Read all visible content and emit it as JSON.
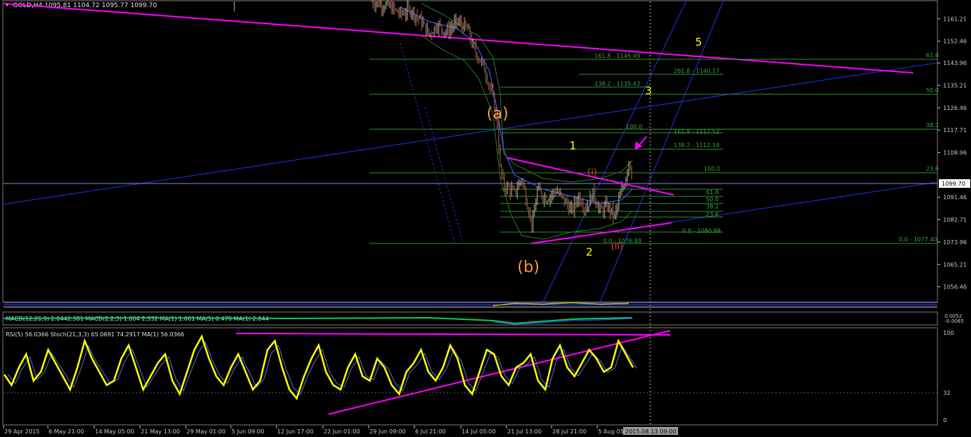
{
  "symbol_header": "GOLD,H4  1095.81 1104.72 1095.77 1099.70",
  "macd_header": "MACD(12,26,9) 2.0442.381 MACD(2,2,3) 1.004 2.332 MA(1) 1.001 MA(5) 0.470 MA(1) 2.044",
  "rsi_header": "RSI(5) 56.0366  Stoch(21,3,3) 65.0691 74.2917  MA(1) 56.0366",
  "current_price": "1099.70",
  "cursor_time": "2015.08.13 09:00",
  "colors": {
    "bg": "#000000",
    "grid": "#1e1e1e",
    "magenta": "#ff00ff",
    "blue": "#1c33e6",
    "fib": "#2f8f2f",
    "yellow": "#ffff00",
    "orange": "#ff9933",
    "red": "#e53b2c"
  },
  "chart_data": [
    {
      "type": "line",
      "name": "price",
      "ylim": [
        1050.5,
        1168
      ],
      "y_ticks": [
        "1161.21",
        "1152.46",
        "1143.96",
        "1135.21",
        "1126.46",
        "1117.71",
        "1108.96",
        "1099.70",
        "1091.46",
        "1082.71",
        "1073.96",
        "1065.21",
        "1056.46"
      ],
      "x_ticks": [
        "29 Apr 2015",
        "6 May 21:00",
        "14 May 05:00",
        "21 May 13:00",
        "29 May 01:00",
        "5 Jun 09:00",
        "12 Jun 17:00",
        "22 Jun 01:00",
        "29 Jun 09:00",
        "6 Jul 21:00",
        "14 Jul 05:00",
        "21 Jul 13:00",
        "28 Jul 21:00",
        "5 Aug 05:00"
      ],
      "price_path": [
        [
          520,
          1168
        ],
        [
          545,
          1166
        ],
        [
          560,
          1163
        ],
        [
          575,
          1165
        ],
        [
          590,
          1160
        ],
        [
          600,
          1155
        ],
        [
          612,
          1159
        ],
        [
          625,
          1156
        ],
        [
          640,
          1160
        ],
        [
          655,
          1157
        ],
        [
          662,
          1150
        ],
        [
          672,
          1145
        ],
        [
          680,
          1140
        ],
        [
          690,
          1130
        ],
        [
          696,
          1120
        ],
        [
          700,
          1103
        ],
        [
          705,
          1096
        ],
        [
          712,
          1095
        ],
        [
          720,
          1093
        ],
        [
          730,
          1099
        ],
        [
          745,
          1080
        ],
        [
          752,
          1094
        ],
        [
          765,
          1091
        ],
        [
          778,
          1094
        ],
        [
          790,
          1090
        ],
        [
          800,
          1086
        ],
        [
          810,
          1092
        ],
        [
          820,
          1087
        ],
        [
          830,
          1093
        ],
        [
          840,
          1086
        ],
        [
          850,
          1088
        ],
        [
          860,
          1084
        ],
        [
          868,
          1092
        ],
        [
          874,
          1097
        ],
        [
          880,
          1106
        ],
        [
          885,
          1099.7
        ]
      ],
      "fibonacci_labels": [
        "161.8 - 1145.49",
        "261.8 - 1140.17",
        "138.2 - 1135.43",
        "100.0",
        "161.8 - 1117.52",
        "138.2 - 1112.18",
        "100.0",
        "0.0 - 1077.40",
        "61.8",
        "50.0",
        "38.2",
        "23.6",
        "0.0 - 1080.88",
        "0.0 - 1076.88",
        "61.8",
        "50.0",
        "38.2",
        "23.6"
      ],
      "wave_labels": [
        {
          "text": "(a)",
          "color": "orange"
        },
        {
          "text": "(b)",
          "color": "orange"
        },
        {
          "text": "1",
          "color": "yellow"
        },
        {
          "text": "2",
          "color": "yellow"
        },
        {
          "text": "3",
          "color": "yellow"
        },
        {
          "text": "5",
          "color": "yellow"
        },
        {
          "text": "(i)",
          "color": "red"
        },
        {
          "text": "(ii)",
          "color": "red"
        }
      ]
    },
    {
      "type": "line",
      "name": "MACD",
      "y_ticks": [
        "0.0052",
        "-0.0065"
      ]
    },
    {
      "type": "line",
      "name": "RSI/Stoch",
      "ylim": [
        0,
        100
      ],
      "y_ticks": [
        "100",
        "32",
        "0"
      ],
      "rsi": [
        52,
        40,
        60,
        75,
        45,
        55,
        80,
        65,
        50,
        35,
        60,
        90,
        70,
        55,
        40,
        45,
        70,
        85,
        60,
        35,
        50,
        65,
        75,
        45,
        30,
        55,
        80,
        95,
        70,
        50,
        40,
        60,
        75,
        55,
        35,
        45,
        80,
        90,
        60,
        35,
        25,
        50,
        70,
        85,
        55,
        40,
        35,
        60,
        75,
        50,
        45,
        70,
        60,
        40,
        30,
        55,
        65,
        80,
        55,
        45,
        60,
        85,
        70,
        40,
        30,
        55,
        80,
        75,
        50,
        40,
        60,
        65,
        75,
        45,
        35,
        70,
        85,
        60,
        50,
        65,
        80,
        70,
        55,
        60,
        90,
        75,
        60
      ]
    }
  ]
}
